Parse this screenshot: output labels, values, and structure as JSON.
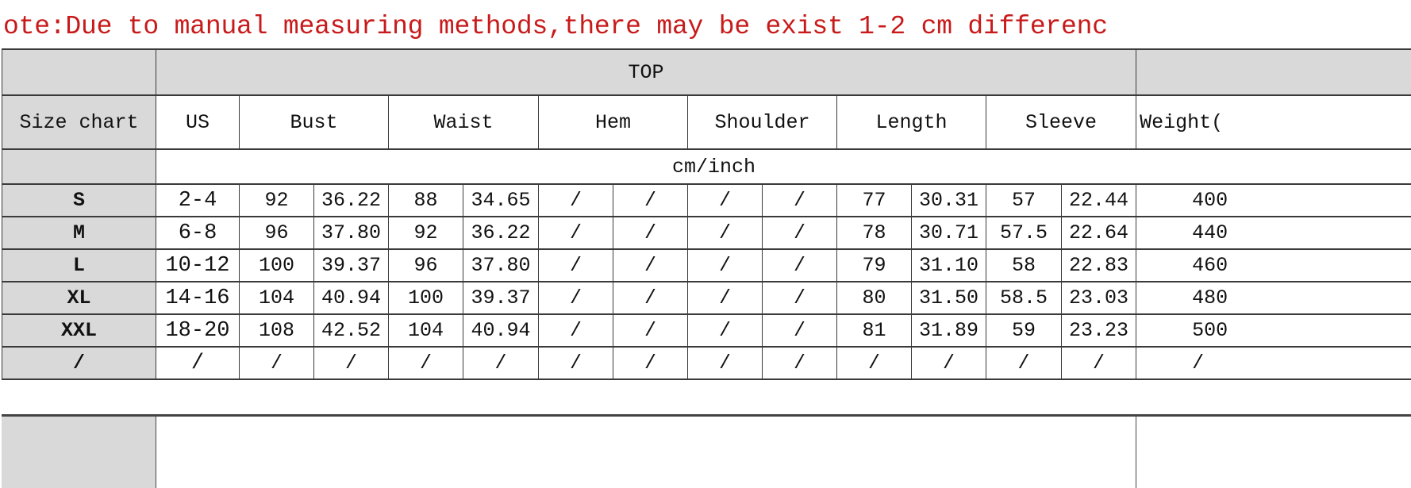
{
  "note": "ote:Due to manual measuring methods,there may be exist 1-2 cm differenc",
  "colors": {
    "note": "#c81a1a",
    "header_bg": "#d9d9d9",
    "border": "#3a3a3a"
  },
  "table": {
    "group_title": "TOP",
    "corner_label": "Size chart",
    "headers": [
      "US",
      "Bust",
      "Waist",
      "Hem",
      "Shoulder",
      "Length",
      "Sleeve",
      "Weight("
    ],
    "unit": "cm/inch",
    "rows": [
      {
        "size": "S",
        "cells": [
          "2-4",
          "92",
          "36.22",
          "88",
          "34.65",
          "/",
          "/",
          "/",
          "/",
          "77",
          "30.31",
          "57",
          "22.44",
          "400"
        ]
      },
      {
        "size": "M",
        "cells": [
          "6-8",
          "96",
          "37.80",
          "92",
          "36.22",
          "/",
          "/",
          "/",
          "/",
          "78",
          "30.71",
          "57.5",
          "22.64",
          "440"
        ]
      },
      {
        "size": "L",
        "cells": [
          "10-12",
          "100",
          "39.37",
          "96",
          "37.80",
          "/",
          "/",
          "/",
          "/",
          "79",
          "31.10",
          "58",
          "22.83",
          "460"
        ]
      },
      {
        "size": "XL",
        "cells": [
          "14-16",
          "104",
          "40.94",
          "100",
          "39.37",
          "/",
          "/",
          "/",
          "/",
          "80",
          "31.50",
          "58.5",
          "23.03",
          "480"
        ]
      },
      {
        "size": "XXL",
        "cells": [
          "18-20",
          "108",
          "42.52",
          "104",
          "40.94",
          "/",
          "/",
          "/",
          "/",
          "81",
          "31.89",
          "59",
          "23.23",
          "500"
        ]
      },
      {
        "size": "/",
        "cells": [
          "/",
          "/",
          "/",
          "/",
          "/",
          "/",
          "/",
          "/",
          "/",
          "/",
          "/",
          "/",
          "/",
          "/"
        ]
      }
    ]
  }
}
